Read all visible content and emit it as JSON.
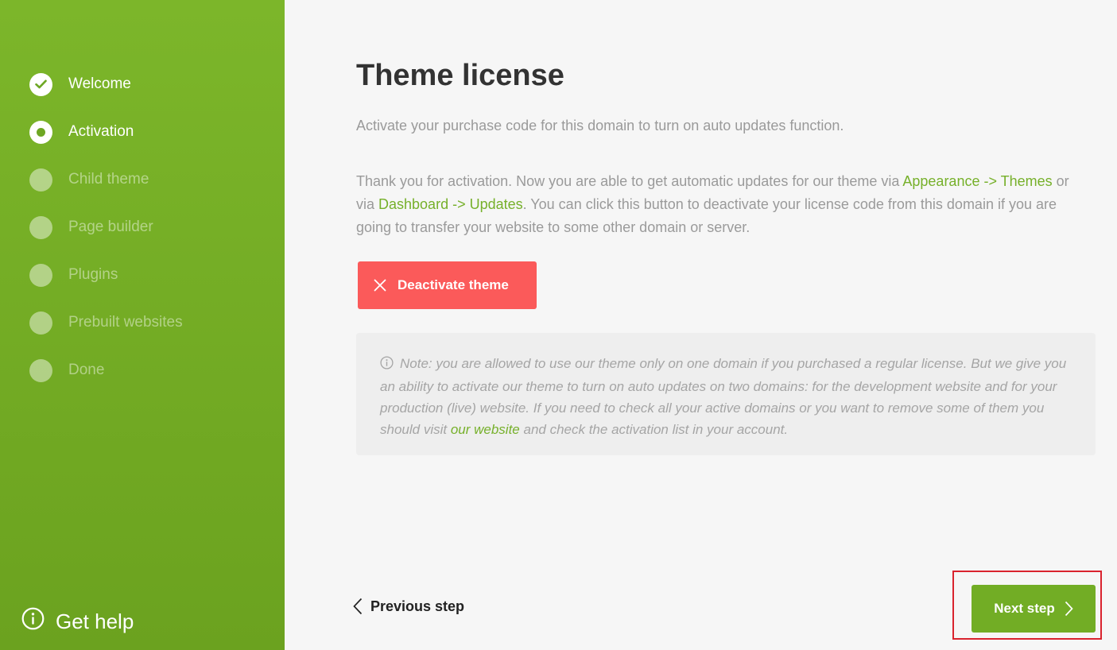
{
  "sidebar": {
    "steps": [
      {
        "label": "Welcome",
        "state": "done"
      },
      {
        "label": "Activation",
        "state": "active"
      },
      {
        "label": "Child theme",
        "state": "pending"
      },
      {
        "label": "Page builder",
        "state": "pending"
      },
      {
        "label": "Plugins",
        "state": "pending"
      },
      {
        "label": "Prebuilt websites",
        "state": "pending"
      },
      {
        "label": "Done",
        "state": "pending"
      }
    ],
    "help_label": "Get help"
  },
  "main": {
    "title": "Theme license",
    "subtitle": "Activate your purchase code for this domain to turn on auto updates function.",
    "para": {
      "part1": "Thank you for activation. Now you are able to get automatic updates for our theme via ",
      "link1": "Appearance -> Themes",
      "part2": " or via ",
      "link2": "Dashboard -> Updates",
      "part3": ". You can click this button to deactivate your license code from this domain if you are going to transfer your website to some other domain or server."
    },
    "deactivate_label": "Deactivate theme",
    "note": {
      "part1": "Note: you are allowed to use our theme only on one domain if you purchased a regular license. But we give you an ability to activate our theme to turn on auto updates on two domains: for the development website and for your production (live) website. If you need to check all your active domains or you want to remove some of them you should visit ",
      "link": "our website",
      "part2": " and check the activation list in your account."
    }
  },
  "footer": {
    "prev_label": "Previous step",
    "next_label": "Next step"
  },
  "colors": {
    "sidebar_green": "#7cb62a",
    "accent_green": "#76b02a",
    "deactivate_red": "#fb5a5a",
    "highlight_red": "#d9232e"
  }
}
